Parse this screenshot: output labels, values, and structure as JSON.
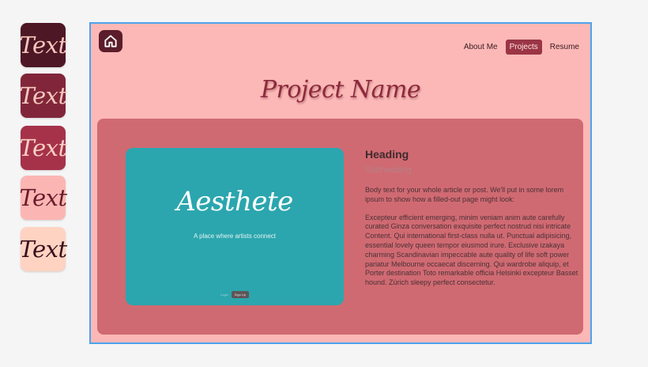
{
  "swatches": [
    "Text",
    "Text",
    "Text",
    "Text",
    "Text"
  ],
  "colors": {
    "palette": [
      "#4e1725",
      "#81263a",
      "#a6324a",
      "#fbb6b3",
      "#fed3c2"
    ],
    "frame_bg": "#fcb8b6",
    "panel_bg": "#d06a72",
    "preview_bg": "#2ba6ae",
    "selection_border": "#4ca3ee"
  },
  "nav": {
    "home_icon": "home-icon",
    "items": [
      {
        "label": "About Me",
        "active": false
      },
      {
        "label": "Projects",
        "active": true
      },
      {
        "label": "Resume",
        "active": false
      }
    ]
  },
  "project": {
    "title": "Project Name",
    "preview": {
      "brand": "Aesthete",
      "tagline": "A place where artists connect",
      "login": "Login",
      "signup": "Sign Up"
    },
    "heading": "Heading",
    "subheading": "Subheading",
    "body1": "Body text for your whole article or post. We'll put in some lorem ipsum to show how a filled-out page might look:",
    "body2": "Excepteur efficient emerging, minim veniam anim aute carefully curated Ginza conversation exquisite perfect nostrud nisi intricate Content. Qui  international first-class nulla ut. Punctual adipisicing, essential lovely queen tempor eiusmod irure. Exclusive izakaya charming Scandinavian impeccable aute quality of life soft power pariatur Melbourne occaecat discerning. Qui wardrobe aliquip, et Porter destination Toto remarkable officia Helsinki excepteur Basset hound. Zürich sleepy perfect consectetur."
  }
}
